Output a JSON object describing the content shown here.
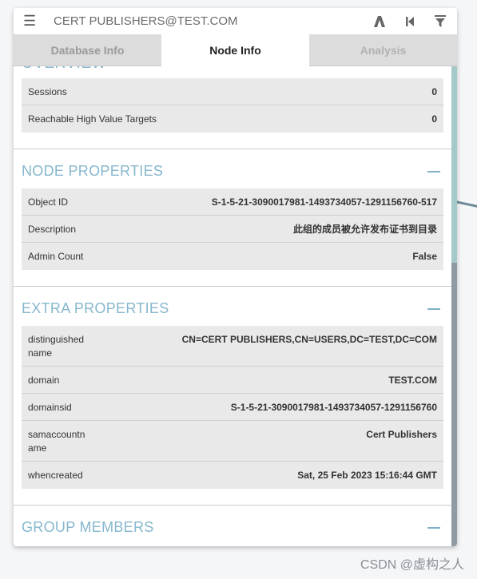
{
  "header": {
    "title": "CERT PUBLISHERS@TEST.COM",
    "icons": [
      "menu-icon",
      "pathfinding-icon",
      "back-icon",
      "filter-icon"
    ]
  },
  "tabs": [
    {
      "label": "Database Info",
      "active": false
    },
    {
      "label": "Node Info",
      "active": true
    },
    {
      "label": "Analysis",
      "active": false
    }
  ],
  "overview": {
    "heading_partial": "OVERVIEW",
    "rows": [
      {
        "label": "Sessions",
        "value": "0"
      },
      {
        "label": "Reachable High Value Targets",
        "value": "0"
      }
    ]
  },
  "node_properties": {
    "title": "NODE PROPERTIES",
    "rows": [
      {
        "label": "Object ID",
        "value": "S-1-5-21-3090017981-1493734057-1291156760-517"
      },
      {
        "label": "Description",
        "value": "此组的成员被允许发布证书到目录"
      },
      {
        "label": "Admin Count",
        "value": "False"
      }
    ]
  },
  "extra_properties": {
    "title": "EXTRA PROPERTIES",
    "rows": [
      {
        "label": "distinguished name",
        "value": "CN=CERT PUBLISHERS,CN=USERS,DC=TEST,DC=COM"
      },
      {
        "label": "domain",
        "value": "TEST.COM"
      },
      {
        "label": "domainsid",
        "value": "S-1-5-21-3090017981-1493734057-1291156760"
      },
      {
        "label": "samaccountn ame",
        "value": "Cert Publishers"
      },
      {
        "label": "whencreated",
        "value": "Sat, 25 Feb 2023 15:16:44 GMT"
      }
    ]
  },
  "group_members": {
    "title": "GROUP MEMBERS"
  },
  "watermark": "CSDN @虚构之人",
  "colors": {
    "section_title": "#86b7cd",
    "row_bg": "#e9e9e9",
    "tab_inactive_bg": "#dcdcdc",
    "scroll_thumb": "#a5c9c9"
  }
}
